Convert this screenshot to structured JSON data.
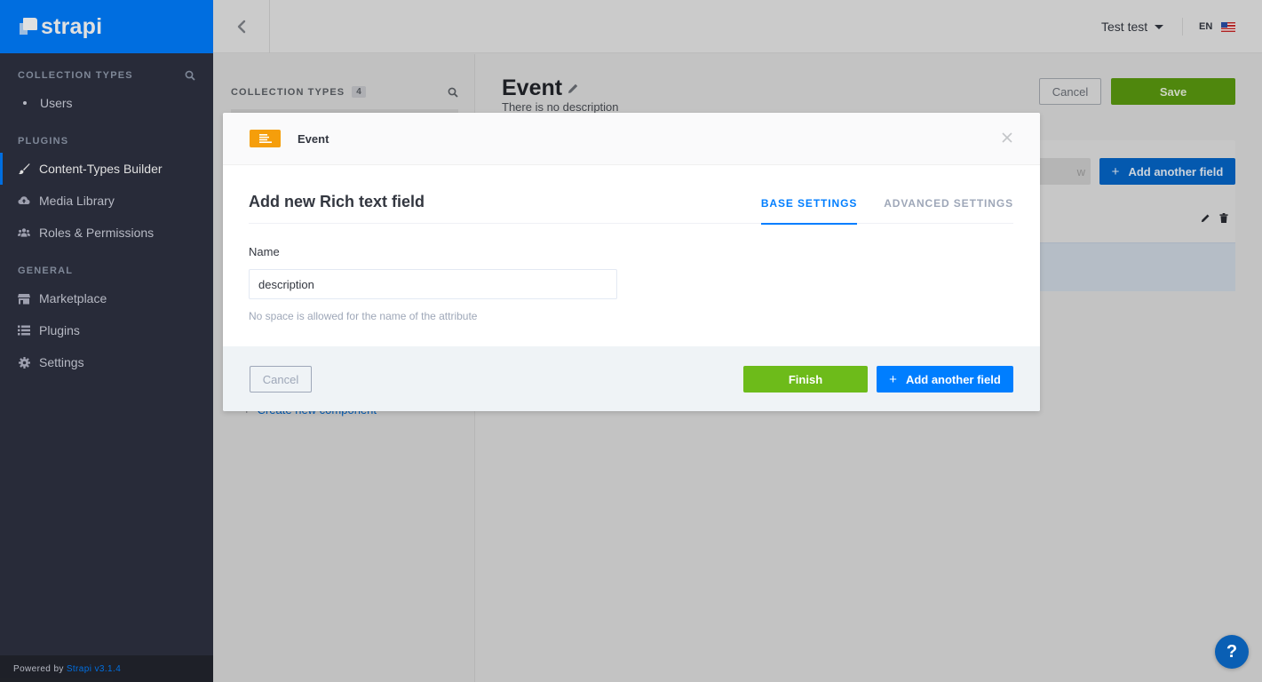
{
  "brand": {
    "name": "strapi"
  },
  "sidebar": {
    "collection_types": {
      "heading": "COLLECTION TYPES",
      "items": [
        {
          "label": "Users"
        }
      ]
    },
    "plugins": {
      "heading": "PLUGINS",
      "items": [
        {
          "label": "Content-Types Builder",
          "icon": "paint-brush-icon",
          "active": true
        },
        {
          "label": "Media Library",
          "icon": "cloud-upload-icon"
        },
        {
          "label": "Roles & Permissions",
          "icon": "users-icon"
        }
      ]
    },
    "general": {
      "heading": "GENERAL",
      "items": [
        {
          "label": "Marketplace",
          "icon": "shop-icon"
        },
        {
          "label": "Plugins",
          "icon": "list-icon"
        },
        {
          "label": "Settings",
          "icon": "gear-icon"
        }
      ]
    },
    "footer": {
      "prefix": "Powered by",
      "link": "Strapi v3.1.4"
    }
  },
  "topbar": {
    "user": "Test test",
    "language": "EN"
  },
  "ctb_panel": {
    "heading": "COLLECTION TYPES",
    "count": "4",
    "create_component": "Create new component"
  },
  "content_type": {
    "title": "Event",
    "description": "There is no description",
    "cancel_label": "Cancel",
    "save_label": "Save",
    "add_field_label": "Add another field"
  },
  "modal": {
    "header_title": "Event",
    "title": "Add new Rich text field",
    "tabs": [
      {
        "label": "BASE SETTINGS",
        "active": true
      },
      {
        "label": "ADVANCED SETTINGS",
        "active": false
      }
    ],
    "name_label": "Name",
    "name_value": "description",
    "name_hint": "No space is allowed for the name of the attribute",
    "cancel_label": "Cancel",
    "finish_label": "Finish",
    "add_another_label": "Add another field"
  },
  "help": {
    "label": "?"
  },
  "colors": {
    "brand_blue": "#007eff",
    "sidebar_bg": "#2e3141",
    "success_green": "#6dbb1a",
    "type_icon_orange": "#f59e0b"
  }
}
